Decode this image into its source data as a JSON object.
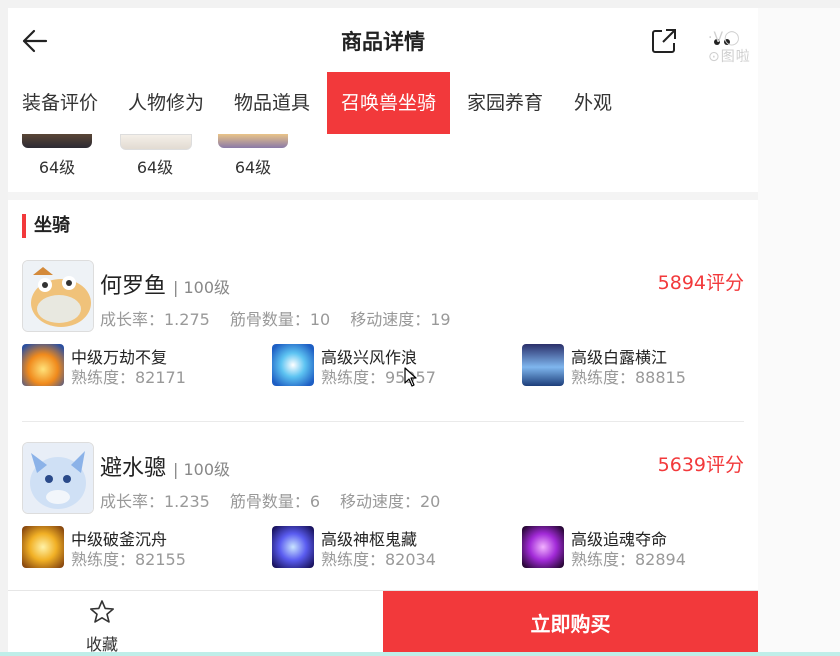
{
  "header": {
    "title": "商品详情",
    "watermark": "·V◯ ⊙图啦"
  },
  "tabs": [
    {
      "label": "装备评价",
      "active": false
    },
    {
      "label": "人物修为",
      "active": false
    },
    {
      "label": "物品道具",
      "active": false
    },
    {
      "label": "召唤兽坐骑",
      "active": true
    },
    {
      "label": "家园养育",
      "active": false
    },
    {
      "label": "外观",
      "active": false
    }
  ],
  "pets": [
    {
      "level": "64级"
    },
    {
      "level": "64级"
    },
    {
      "level": "64级"
    }
  ],
  "mounts_section": {
    "title": "坐骑",
    "mounts": [
      {
        "name": "何罗鱼",
        "level": "| 100级",
        "score": "5894评分",
        "stats": [
          "成长率：1.275",
          "筋骨数量：10",
          "移动速度：19"
        ],
        "skills": [
          {
            "name": "中级万劫不复",
            "proficiency": "熟练度：82171"
          },
          {
            "name": "高级兴风作浪",
            "proficiency": "熟练度：95957"
          },
          {
            "name": "高级白露横江",
            "proficiency": "熟练度：88815"
          }
        ]
      },
      {
        "name": "避水骢",
        "level": "| 100级",
        "score": "5639评分",
        "stats": [
          "成长率：1.235",
          "筋骨数量：6",
          "移动速度：20"
        ],
        "skills": [
          {
            "name": "中级破釜沉舟",
            "proficiency": "熟练度：82155"
          },
          {
            "name": "高级神枢鬼藏",
            "proficiency": "熟练度：82034"
          },
          {
            "name": "高级追魂夺命",
            "proficiency": "熟练度：82894"
          }
        ]
      }
    ]
  },
  "bottom_bar": {
    "favorite_label": "收藏",
    "buy_label": "立即购买"
  },
  "colors": {
    "accent": "#f2393b"
  }
}
